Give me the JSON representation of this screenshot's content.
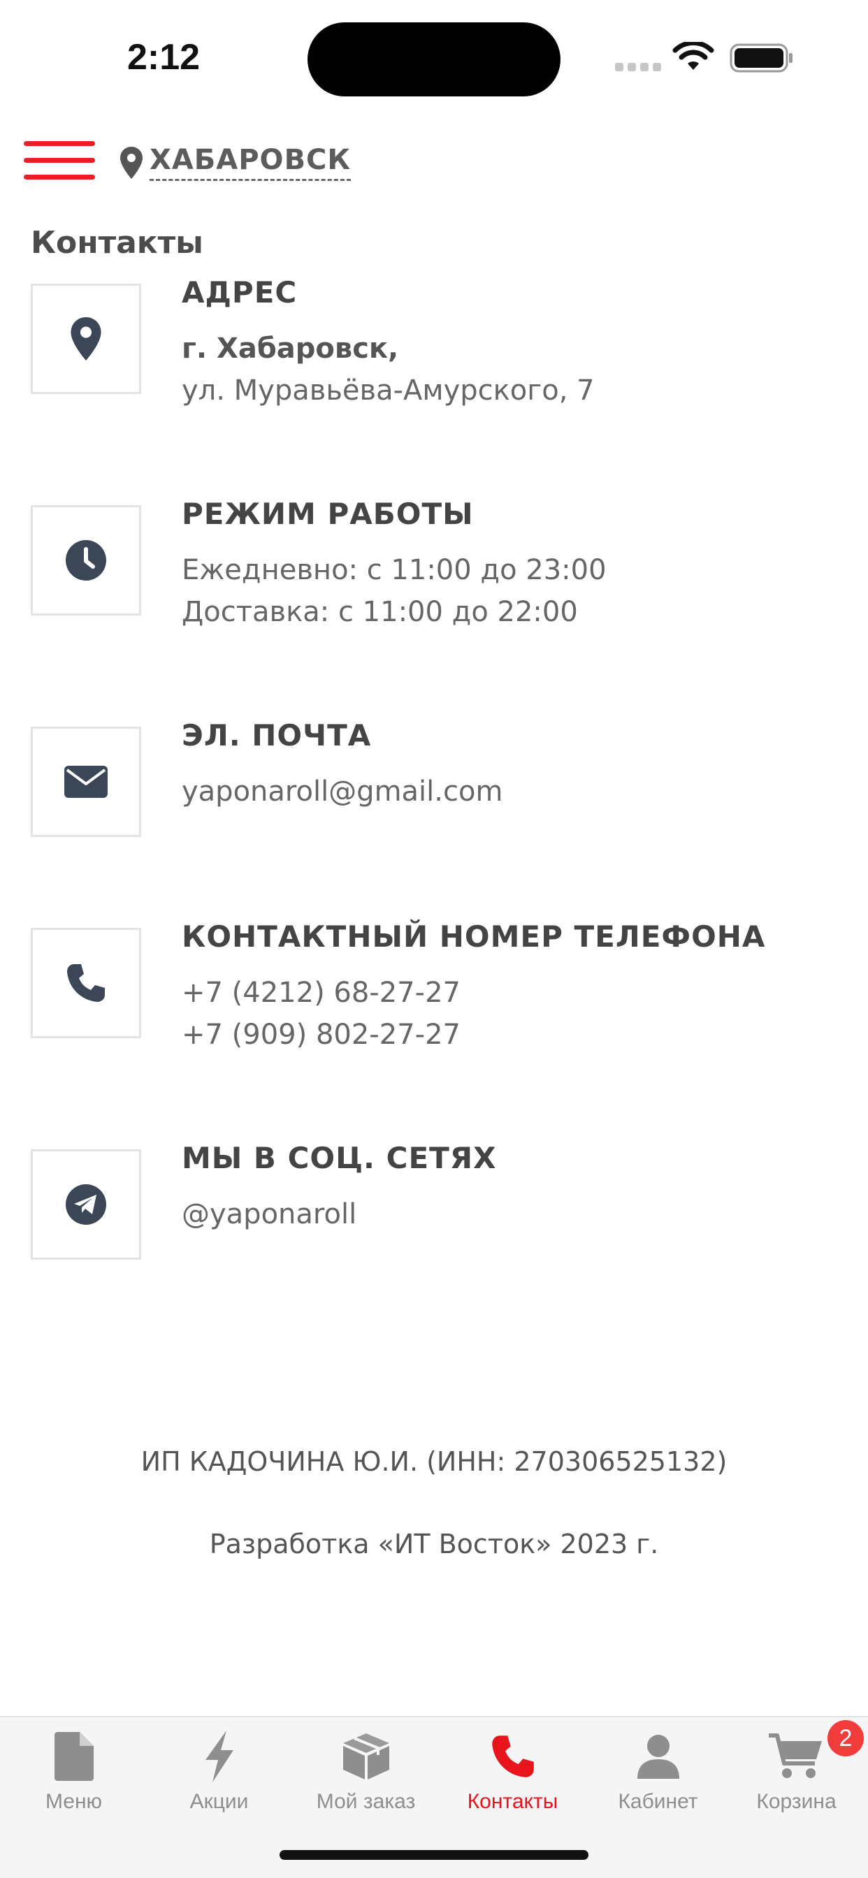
{
  "status_bar": {
    "time": "2:12"
  },
  "header": {
    "city": "ХАБАРОВСК"
  },
  "page_title": "Контакты",
  "contacts": [
    {
      "icon": "map-pin-icon",
      "title": "АДРЕС",
      "lines": [
        "г. Хабаровск,",
        "ул. Муравьёва-Амурского, 7"
      ]
    },
    {
      "icon": "clock-icon",
      "title": "РЕЖИМ РАБОТЫ",
      "lines": [
        "Ежедневно: с 11:00 до 23:00",
        "Доставка: с 11:00 до 22:00"
      ]
    },
    {
      "icon": "envelope-icon",
      "title": "ЭЛ. ПОЧТА",
      "lines": [
        "yaponaroll@gmail.com"
      ]
    },
    {
      "icon": "phone-icon",
      "title": "КОНТАКТНЫЙ НОМЕР ТЕЛЕФОНА",
      "lines": [
        "+7 (4212) 68-27-27",
        "+7 (909) 802-27-27"
      ]
    },
    {
      "icon": "telegram-icon",
      "title": "МЫ В СОЦ. СЕТЯХ",
      "lines": [
        "@yaponaroll"
      ]
    }
  ],
  "footer": {
    "legal": "ИП КАДОЧИНА Ю.И. (ИНН: 270306525132)",
    "developer": "Разработка «ИТ Восток» 2023 г."
  },
  "tabs": [
    {
      "label": "Меню",
      "icon": "document-icon",
      "active": false
    },
    {
      "label": "Акции",
      "icon": "lightning-icon",
      "active": false
    },
    {
      "label": "Мой заказ",
      "icon": "box-icon",
      "active": false
    },
    {
      "label": "Контакты",
      "icon": "phone-icon",
      "active": true
    },
    {
      "label": "Кабинет",
      "icon": "user-icon",
      "active": false
    },
    {
      "label": "Корзина",
      "icon": "cart-icon",
      "active": false
    }
  ],
  "cart_badge": "2",
  "colors": {
    "accent": "#e8141c",
    "icon": "#3b4757",
    "badge": "#f23b3b"
  }
}
